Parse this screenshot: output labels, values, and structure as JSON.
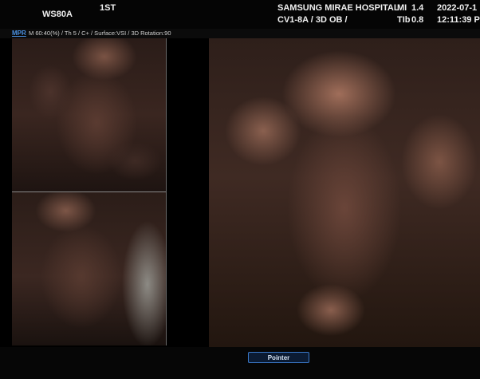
{
  "header": {
    "model": "WS80A",
    "trimester": "1ST",
    "hospital": "SAMSUNG MIRAE HOSPITAL",
    "probe_preset": "CV1-8A / 3D OB /",
    "mi_label": "MI",
    "mi_value": "1.4",
    "tib_label": "TIb",
    "tib_value": "0.8",
    "date": "2022-07-1",
    "time": "12:11:39 P"
  },
  "status": {
    "mode_tab": "MPR",
    "params": "M 60:40(%) / Th 5 / C+ / Surface:VSI / 3D Rotation:90"
  },
  "footer": {
    "pointer_button": "Pointer"
  },
  "colors": {
    "accent": "#3a78c8",
    "tab_blue": "#4a90e0",
    "tissue": "#7a5344"
  }
}
